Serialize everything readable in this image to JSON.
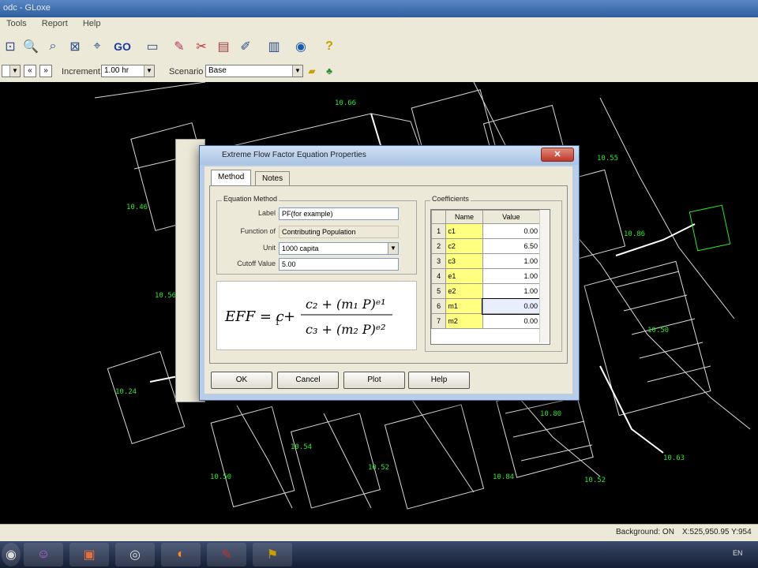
{
  "app": {
    "title": "odc - GLoxe"
  },
  "menu": {
    "items": [
      "Tools",
      "Report",
      "Help"
    ]
  },
  "toolbar": {
    "go_label": "GO"
  },
  "options_bar": {
    "increment_label": "Increment",
    "increment_value": "1.00 hr",
    "scenario_label": "Scenario",
    "scenario_value": "Base"
  },
  "map": {
    "node_labels": [
      "10.66",
      "10.46",
      "10.55",
      "10.86",
      "10.56",
      "10.50",
      "10.24",
      "10.80",
      "10.54",
      "10.50",
      "10.52",
      "10.63",
      "10.52",
      "10.84"
    ]
  },
  "dialog": {
    "title": "Extreme Flow Factor Equation Properties",
    "close": "✕",
    "tabs": [
      "Method",
      "Notes"
    ],
    "equation_method": {
      "group_label": "Equation Method",
      "label_caption": "Label",
      "label_value": "PF(for example)",
      "function_caption": "Function of",
      "function_value": "Contributing Population",
      "unit_caption": "Unit",
      "unit_value": "1000 capita",
      "cutoff_caption": "Cutoff Value",
      "cutoff_value": "5.00"
    },
    "coefficients": {
      "group_label": "Coefficients",
      "headers": [
        "Name",
        "Value"
      ],
      "rows": [
        {
          "n": "1",
          "name": "c1",
          "value": "0.00"
        },
        {
          "n": "2",
          "name": "c2",
          "value": "6.50"
        },
        {
          "n": "3",
          "name": "c3",
          "value": "1.00"
        },
        {
          "n": "4",
          "name": "e1",
          "value": "1.00"
        },
        {
          "n": "5",
          "name": "e2",
          "value": "1.00"
        },
        {
          "n": "6",
          "name": "m1",
          "value": "0.00"
        },
        {
          "n": "7",
          "name": "m2",
          "value": "0.00"
        }
      ]
    },
    "buttons": {
      "ok": "OK",
      "cancel": "Cancel",
      "plot": "Plot",
      "help": "Help"
    }
  },
  "statusbar": {
    "background": "Background: ON",
    "coords": "X:525,950.95  Y:954"
  },
  "taskbar": {
    "tray_lang": "EN"
  }
}
